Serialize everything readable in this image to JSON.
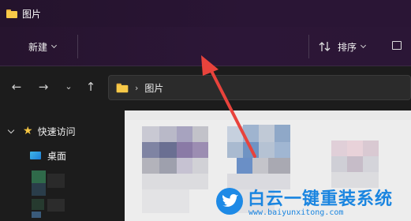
{
  "window": {
    "title": "图片"
  },
  "toolbar": {
    "new_label": "新建",
    "sort_label": "排序"
  },
  "address": {
    "crumb": "图片"
  },
  "nav": {
    "quick_access_label": "快速访问",
    "desktop_label": "桌面"
  },
  "watermark": {
    "title": "白云一键重装系统",
    "url": "www.baiyunxitong.com"
  },
  "colors": {
    "titlebar": "#2a1535",
    "accent_arrow": "#e8433c",
    "folder": "#f7c948",
    "watermark": "#1a85e0"
  },
  "icons": {
    "folder": "folder-icon",
    "back": "arrow-left-icon",
    "forward": "arrow-right-icon",
    "recent": "chevron-down-icon",
    "up": "arrow-up-icon",
    "sort": "sort-icon",
    "view": "view-icon",
    "star": "star-icon",
    "desktop": "desktop-icon"
  }
}
